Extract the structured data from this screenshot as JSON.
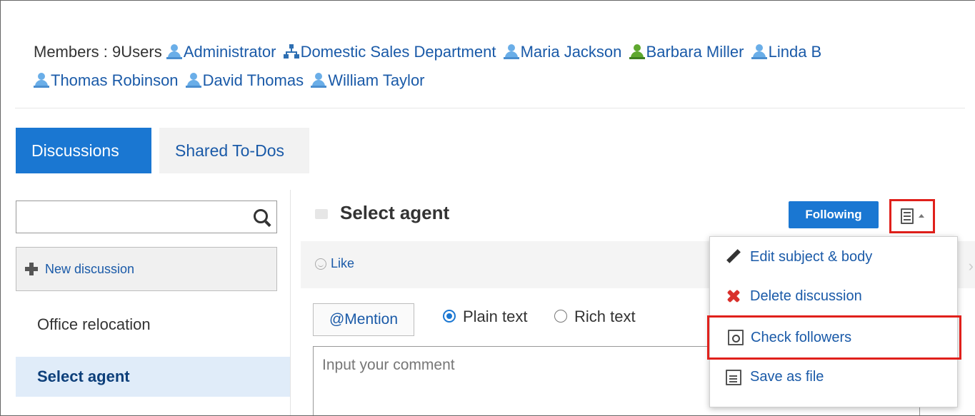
{
  "members": {
    "prefix": "Members : 9Users",
    "list": [
      {
        "name": "Administrator",
        "icon": "user-icon"
      },
      {
        "name": "Domestic Sales Department",
        "icon": "org-icon"
      },
      {
        "name": "Maria Jackson",
        "icon": "user-icon"
      },
      {
        "name": "Barbara Miller",
        "icon": "user-icon-green"
      },
      {
        "name": "Linda B",
        "icon": "user-icon"
      },
      {
        "name": "Thomas Robinson",
        "icon": "user-icon"
      },
      {
        "name": "David Thomas",
        "icon": "user-icon"
      },
      {
        "name": "William Taylor",
        "icon": "user-icon"
      }
    ]
  },
  "tabs": [
    {
      "label": "Discussions",
      "active": true
    },
    {
      "label": "Shared To-Dos",
      "active": false
    }
  ],
  "sidebar": {
    "search_value": "",
    "new_discussion_label": "New discussion",
    "items": [
      {
        "label": "Office relocation",
        "selected": false
      },
      {
        "label": "Select agent",
        "selected": true
      }
    ]
  },
  "main": {
    "title": "Select agent",
    "following_label": "Following",
    "like_label": "Like",
    "mention_label": "@Mention",
    "format_options": [
      {
        "label": "Plain text",
        "checked": true
      },
      {
        "label": "Rich text",
        "checked": false
      }
    ],
    "comment_placeholder": "Input your comment"
  },
  "menu": {
    "items": [
      {
        "label": "Edit subject & body",
        "icon": "pencil-icon"
      },
      {
        "label": "Delete discussion",
        "icon": "x-icon"
      },
      {
        "label": "Check followers",
        "icon": "doc-search-icon",
        "highlighted": true
      },
      {
        "label": "Save as file",
        "icon": "doc-icon"
      }
    ]
  },
  "colors": {
    "accent": "#1a77d2",
    "link": "#1a5aa8",
    "highlight_border": "#e0201b"
  }
}
